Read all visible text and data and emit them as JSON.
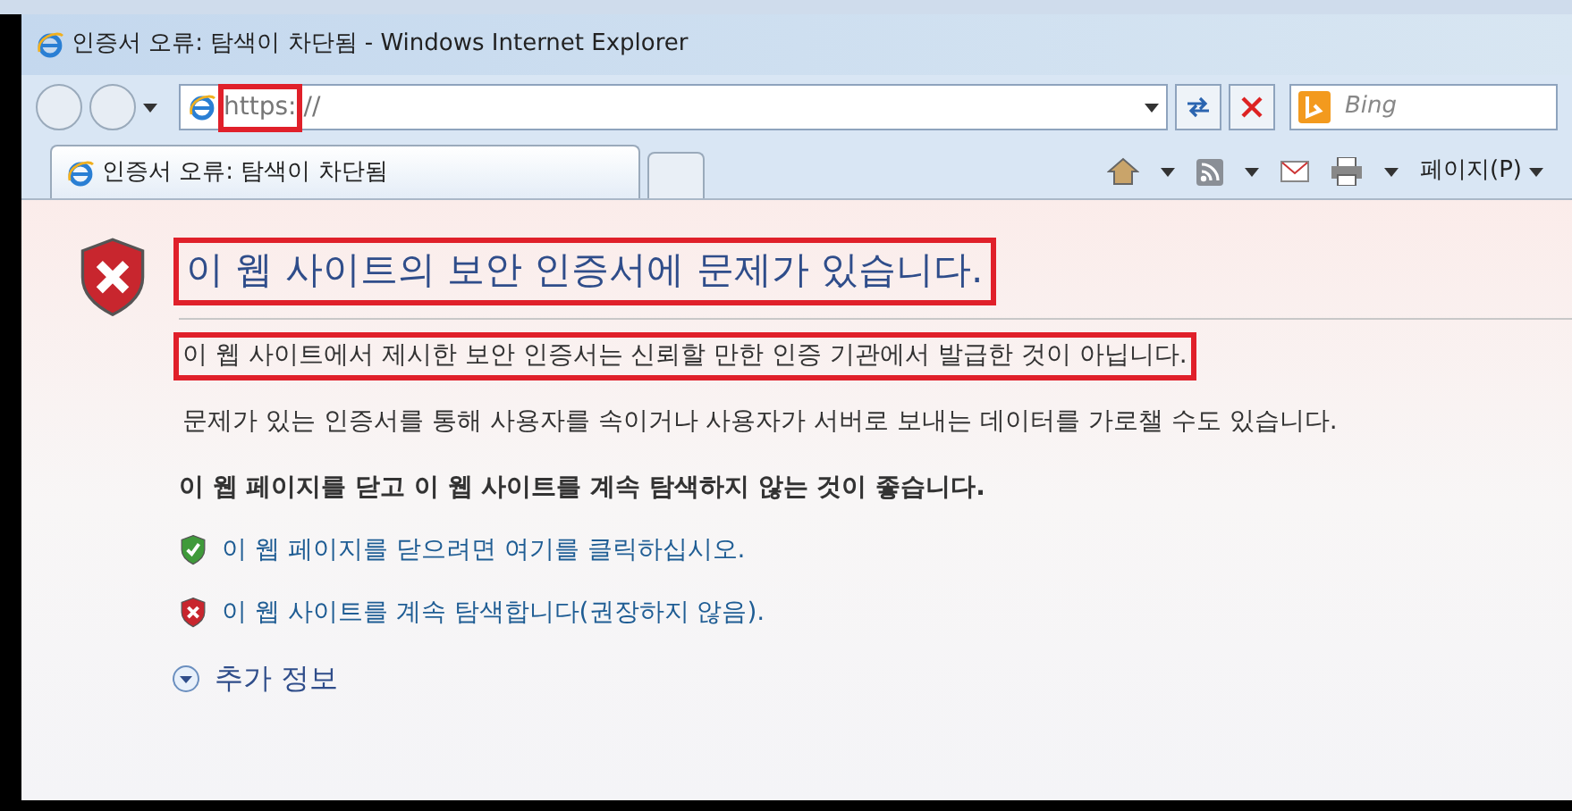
{
  "window": {
    "title": "인증서 오류: 탐색이 차단됨 - Windows Internet Explorer"
  },
  "address_bar": {
    "segments": [
      {
        "text": "https:",
        "highlighted": true
      },
      {
        "text": "//",
        "highlighted": false
      }
    ]
  },
  "search": {
    "placeholder": "Bing"
  },
  "tabs": [
    {
      "label": "인증서 오류: 탐색이 차단됨",
      "selected": true
    }
  ],
  "command_bar": {
    "page_menu": "페이지(P)"
  },
  "content": {
    "heading": {
      "text": "이 웹 사이트의 보안 인증서에 문제가 있습니다.",
      "highlighted": true
    },
    "paragraphs": [
      {
        "text": "이 웹 사이트에서 제시한 보안 인증서는 신뢰할 만한 인증 기관에서 발급한 것이 아닙니다.",
        "highlighted": true
      },
      {
        "text": "문제가 있는 인증서를 통해 사용자를 속이거나 사용자가 서버로 보내는 데이터를 가로챌 수도 있습니다.",
        "highlighted": false
      }
    ],
    "recommendation": "이 웹 페이지를 닫고 이 웹 사이트를 계속 탐색하지 않는 것이 좋습니다.",
    "links": [
      {
        "kind": "safe",
        "text": "이 웹 페이지를 닫으려면 여기를 클릭하십시오."
      },
      {
        "kind": "unsafe",
        "text": "이 웹 사이트를 계속 탐색합니다(권장하지 않음)."
      }
    ],
    "more_info": "추가 정보"
  }
}
